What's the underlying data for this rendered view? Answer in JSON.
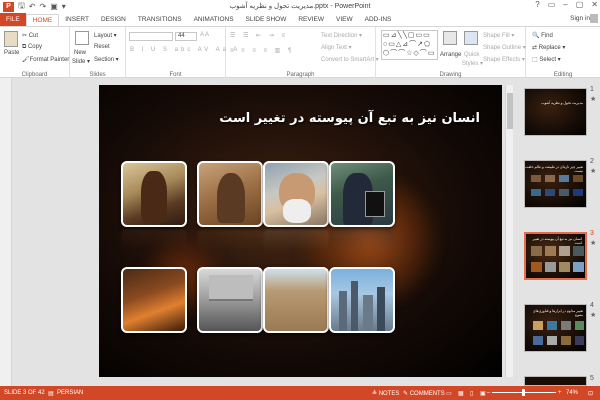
{
  "app": {
    "title": "مدیریت تحول و نظریه آشوب.pptx - PowerPoint",
    "logo_letter": "P",
    "qa_icons": [
      "save-icon",
      "undo-icon",
      "redo-icon",
      "start-slideshow-icon"
    ],
    "window_controls": [
      "?",
      "▭",
      "–",
      "▢",
      "✕"
    ]
  },
  "tabs": [
    "FILE",
    "HOME",
    "INSERT",
    "DESIGN",
    "TRANSITIONS",
    "ANIMATIONS",
    "SLIDE SHOW",
    "REVIEW",
    "VIEW",
    "ADD-INS"
  ],
  "active_tab": "HOME",
  "signin": "Sign in",
  "ribbon": {
    "clipboard": {
      "label": "Clipboard",
      "paste": "Paste",
      "cut": "Cut",
      "copy": "Copy",
      "format_painter": "Format Painter"
    },
    "slides": {
      "label": "Slides",
      "new_slide": "New",
      "new_slide2": "Slide ▾",
      "layout": "Layout ▾",
      "reset": "Reset",
      "section": "Section ▾"
    },
    "font": {
      "label": "Font",
      "size": "44"
    },
    "paragraph": {
      "label": "Paragraph",
      "text_direction": "Text Direction ▾",
      "align_text": "Align Text ▾",
      "convert": "Convert to SmartArt ▾"
    },
    "drawing": {
      "label": "Drawing",
      "shapes": "▭⊿╲╲▢▭▭ ○▭△⊿⌒↗⬠ ⬡⌒⌒☆◇⌒▭",
      "arrange": "Arrange",
      "quick_styles": "Quick",
      "quick_styles2": "Styles ▾",
      "shape_fill": "Shape Fill ▾",
      "shape_outline": "Shape Outline ▾",
      "shape_effects": "Shape Effects ▾"
    },
    "editing": {
      "label": "Editing",
      "find": "Find",
      "replace": "Replace ▾",
      "select": "Select ▾"
    }
  },
  "slide": {
    "title": "انسان نیز به تبع آن پیوسته در تغییر است"
  },
  "thumbnails": [
    {
      "number": "1",
      "star": "★",
      "text": "مدیریت تحول و نظریه آشوب"
    },
    {
      "number": "2",
      "star": "★",
      "text": "تغییر چیز تازه‌ای در طبیعت و عالم خلقت نیست"
    },
    {
      "number": "3",
      "star": "★",
      "text": "انسان نیز به تبع آن پیوسته در تغییر است"
    },
    {
      "number": "4",
      "star": "★",
      "text": "تغییر مداوم در ابزارها و فناوری‌های متنوع"
    },
    {
      "number": "5",
      "star": ""
    }
  ],
  "status": {
    "slide": "SLIDE 3 OF 42",
    "language": "PERSIAN",
    "notes": "NOTES",
    "comments": "COMMENTS",
    "zoom": "74%"
  },
  "colors": {
    "accent": "#d24726",
    "slide_bg": "#1a0d06"
  }
}
